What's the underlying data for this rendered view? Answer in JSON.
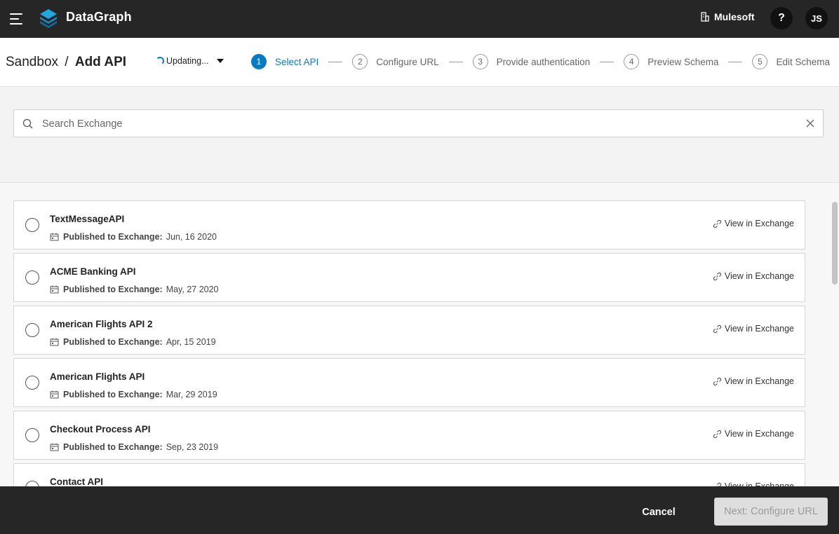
{
  "app": {
    "name": "DataGraph"
  },
  "topbar": {
    "org": "Mulesoft",
    "help_label": "?",
    "avatar_initials": "JS"
  },
  "breadcrumb": {
    "parent": "Sandbox",
    "separator": "/",
    "current": "Add API"
  },
  "environment": {
    "status": "Updating..."
  },
  "steps": [
    {
      "number": "1",
      "label": "Select API",
      "active": true
    },
    {
      "number": "2",
      "label": "Configure URL"
    },
    {
      "number": "3",
      "label": "Provide authentication"
    },
    {
      "number": "4",
      "label": "Preview Schema"
    },
    {
      "number": "5",
      "label": "Edit Schema"
    }
  ],
  "search": {
    "placeholder": "Search Exchange",
    "value": ""
  },
  "api_list": {
    "published_label": "Published to Exchange:",
    "view_label": "View in Exchange",
    "items": [
      {
        "name": "TextMessageAPI",
        "date": "Jun, 16 2020"
      },
      {
        "name": "ACME Banking API",
        "date": "May, 27 2020"
      },
      {
        "name": "American Flights API 2",
        "date": "Apr, 15 2019"
      },
      {
        "name": "American Flights API",
        "date": "Mar, 29 2019"
      },
      {
        "name": "Checkout Process API",
        "date": "Sep, 23 2019"
      },
      {
        "name": "Contact API",
        "date": ""
      }
    ]
  },
  "footer": {
    "cancel_label": "Cancel",
    "next_label": "Next: Configure URL"
  },
  "colors": {
    "accent": "#0b7bc1",
    "topbar": "#262626"
  }
}
